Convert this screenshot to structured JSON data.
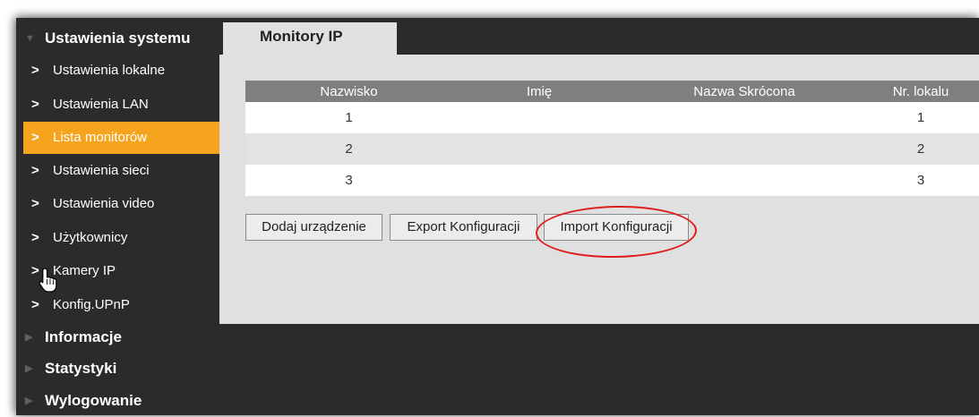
{
  "sidebar": {
    "system_section": "Ustawienia systemu",
    "items": [
      {
        "label": "Ustawienia lokalne",
        "active": false
      },
      {
        "label": "Ustawienia LAN",
        "active": false
      },
      {
        "label": "Lista monitorów",
        "active": true
      },
      {
        "label": "Ustawienia sieci",
        "active": false
      },
      {
        "label": "Ustawienia video",
        "active": false
      },
      {
        "label": "Użytkownicy",
        "active": false
      },
      {
        "label": "Kamery IP",
        "active": false
      },
      {
        "label": "Konfig.UPnP",
        "active": false
      }
    ],
    "other_sections": [
      "Informacje",
      "Statystyki",
      "Wylogowanie"
    ]
  },
  "tab": {
    "label": "Monitory IP"
  },
  "table": {
    "columns": [
      "Nazwisko",
      "Imię",
      "Nazwa Skrócona",
      "Nr. lokalu"
    ],
    "rows": [
      [
        "1",
        "",
        "",
        "1"
      ],
      [
        "2",
        "",
        "",
        "2"
      ],
      [
        "3",
        "",
        "",
        "3"
      ]
    ]
  },
  "buttons": {
    "add": "Dodaj urządzenie",
    "export": "Export Konfiguracji",
    "import": "Import Konfiguracji"
  },
  "colors": {
    "sidebar_bg": "#2b2b2b",
    "active_item": "#f6a31e",
    "table_header": "#7f7f7f",
    "annotation": "#e01d1d"
  }
}
